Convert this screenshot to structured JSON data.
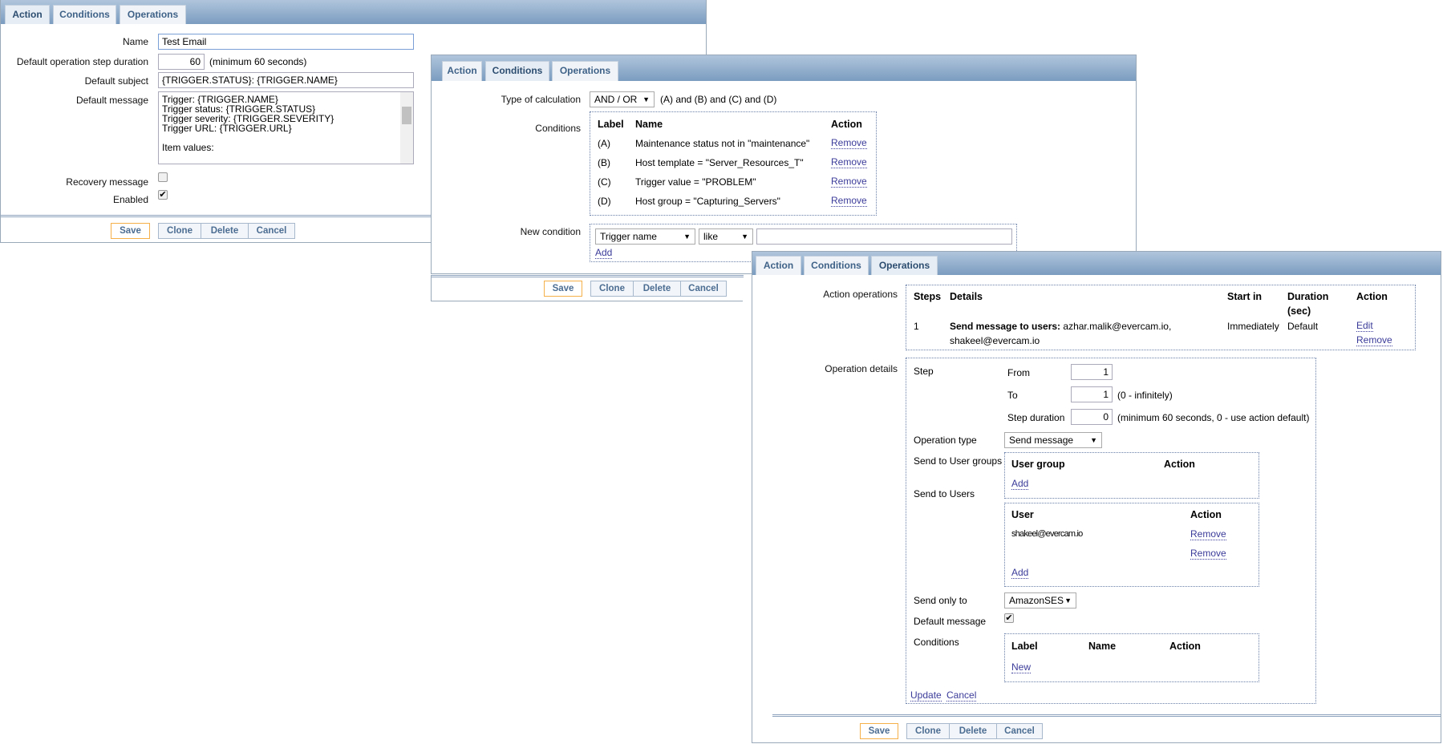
{
  "tabs": {
    "action": "Action",
    "conditions": "Conditions",
    "operations": "Operations"
  },
  "buttons": {
    "save": "Save",
    "clone": "Clone",
    "delete": "Delete",
    "cancel": "Cancel"
  },
  "action_panel": {
    "name_label": "Name",
    "name_value": "Test Email",
    "step_label": "Default operation step duration",
    "step_value": "60",
    "step_hint": "(minimum 60 seconds)",
    "subject_label": "Default subject",
    "subject_value": "{TRIGGER.STATUS}: {TRIGGER.NAME}",
    "message_label": "Default message",
    "message_value": "Trigger: {TRIGGER.NAME}\nTrigger status: {TRIGGER.STATUS}\nTrigger severity: {TRIGGER.SEVERITY}\nTrigger URL: {TRIGGER.URL}\n\nItem values:",
    "recovery_label": "Recovery message",
    "recovery_checked": false,
    "enabled_label": "Enabled",
    "enabled_checked": true
  },
  "conditions_panel": {
    "calc_label": "Type of calculation",
    "calc_value": "AND / OR",
    "calc_formula": "(A) and (B) and (C) and (D)",
    "conditions_label": "Conditions",
    "headers": {
      "label": "Label",
      "name": "Name",
      "action": "Action"
    },
    "rows": [
      {
        "label": "(A)",
        "name": "Maintenance status not in \"maintenance\"",
        "action": "Remove"
      },
      {
        "label": "(B)",
        "name": "Host template = \"Server_Resources_T\"",
        "action": "Remove"
      },
      {
        "label": "(C)",
        "name": "Trigger value = \"PROBLEM\"",
        "action": "Remove"
      },
      {
        "label": "(D)",
        "name": "Host group = \"Capturing_Servers\"",
        "action": "Remove"
      }
    ],
    "new_condition_label": "New condition",
    "new_type": "Trigger name",
    "new_operator": "like",
    "new_value": "",
    "add": "Add"
  },
  "operations_panel": {
    "action_ops_label": "Action operations",
    "headers": {
      "steps": "Steps",
      "details": "Details",
      "start_in": "Start in",
      "duration": "Duration",
      "duration2": "(sec)",
      "action": "Action"
    },
    "row": {
      "steps": "1",
      "details_bold": "Send message to users:",
      "details": " azhar.malik@evercam.io,",
      "details2": "shakeel@evercam.io",
      "start_in": "Immediately",
      "duration": "Default",
      "edit": "Edit",
      "remove": "Remove"
    },
    "op_details_label": "Operation details",
    "step_label": "Step",
    "from_label": "From",
    "from_value": "1",
    "to_label": "To",
    "to_value": "1",
    "to_hint": "(0 - infinitely)",
    "step_dur_label": "Step duration",
    "step_dur_value": "0",
    "step_dur_hint": "(minimum 60 seconds, 0 - use action default)",
    "op_type_label": "Operation type",
    "op_type_value": "Send message",
    "user_groups_label": "Send to User groups",
    "ug_header": "User group",
    "ug_action": "Action",
    "ug_add": "Add",
    "users_label": "Send to Users",
    "users_header": "User",
    "users_action": "Action",
    "user1": "shakeel@evercam.io",
    "remove": "Remove",
    "users_add": "Add",
    "send_only_label": "Send only to",
    "send_only_value": "AmazonSES",
    "default_msg_label": "Default message",
    "default_msg_checked": true,
    "cond_label": "Conditions",
    "cond_h_label": "Label",
    "cond_h_name": "Name",
    "cond_h_action": "Action",
    "cond_new": "New",
    "update": "Update",
    "cancel": "Cancel"
  }
}
